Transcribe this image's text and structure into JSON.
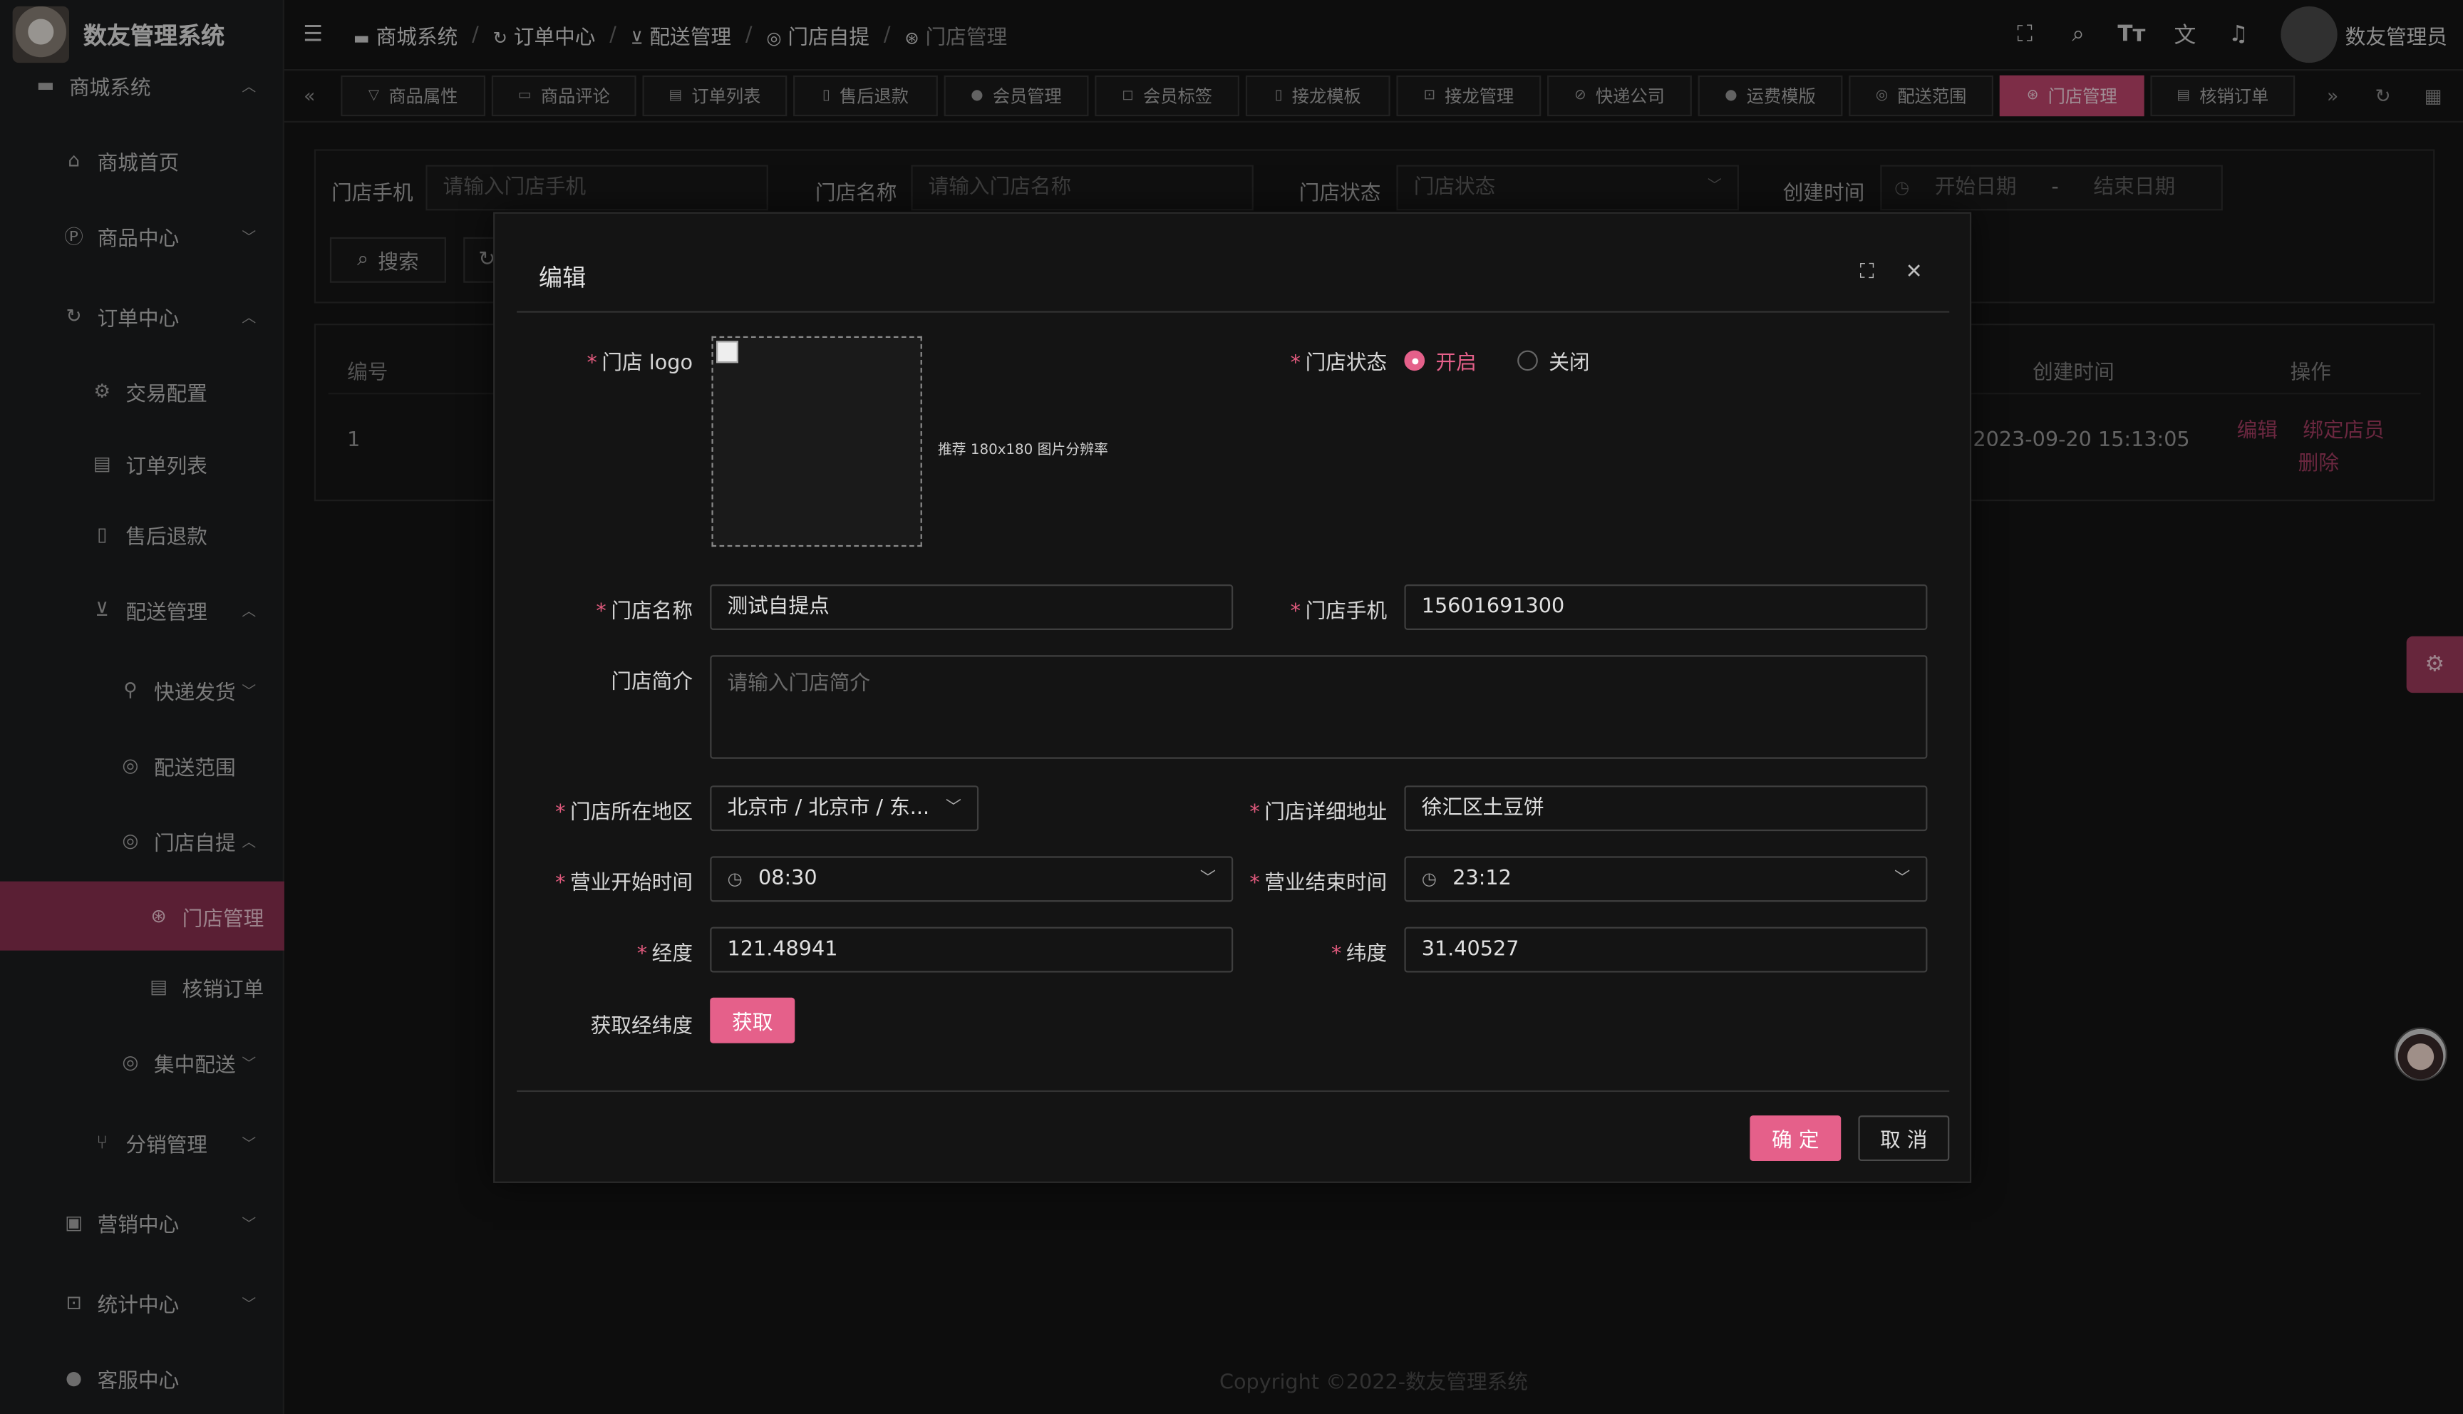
{
  "app": {
    "title": "数友管理系统"
  },
  "sidebar": {
    "items": [
      {
        "label": "商城系统",
        "icon": "store-icon",
        "chevron": "︿"
      },
      {
        "label": "商城首页",
        "icon": "home-icon",
        "chevron": ""
      },
      {
        "label": "商品中心",
        "icon": "product-icon",
        "chevron": "﹀"
      },
      {
        "label": "订单中心",
        "icon": "order-icon",
        "chevron": "︿"
      },
      {
        "label": "交易配置",
        "icon": "gear-icon",
        "chevron": ""
      },
      {
        "label": "订单列表",
        "icon": "clipboard-icon",
        "chevron": ""
      },
      {
        "label": "售后退款",
        "icon": "document-icon",
        "chevron": ""
      },
      {
        "label": "配送管理",
        "icon": "cart-icon",
        "chevron": "︿"
      },
      {
        "label": "快递发货",
        "icon": "bike-icon",
        "chevron": "﹀"
      },
      {
        "label": "配送范围",
        "icon": "location-icon",
        "chevron": ""
      },
      {
        "label": "门店自提",
        "icon": "location-icon",
        "chevron": "︿"
      },
      {
        "label": "门店管理",
        "icon": "aperture-icon",
        "chevron": ""
      },
      {
        "label": "核销订单",
        "icon": "clipboard-icon",
        "chevron": ""
      },
      {
        "label": "集中配送",
        "icon": "location-icon",
        "chevron": "﹀"
      },
      {
        "label": "分销管理",
        "icon": "share-icon",
        "chevron": "﹀"
      },
      {
        "label": "营销中心",
        "icon": "gift-icon",
        "chevron": "﹀"
      },
      {
        "label": "统计中心",
        "icon": "chart-icon",
        "chevron": "﹀"
      },
      {
        "label": "客服中心",
        "icon": "user-icon",
        "chevron": ""
      }
    ]
  },
  "breadcrumb": [
    {
      "label": "商城系统"
    },
    {
      "label": "订单中心"
    },
    {
      "label": "配送管理"
    },
    {
      "label": "门店自提"
    },
    {
      "label": "门店管理"
    }
  ],
  "header": {
    "username": "数友管理员"
  },
  "tabs": [
    {
      "label": "商品属性",
      "icon": "tag-icon"
    },
    {
      "label": "商品评论",
      "icon": "comment-icon"
    },
    {
      "label": "订单列表",
      "icon": "clipboard-icon"
    },
    {
      "label": "售后退款",
      "icon": "document-icon"
    },
    {
      "label": "会员管理",
      "icon": "user-icon"
    },
    {
      "label": "会员标签",
      "icon": "bookmark-icon"
    },
    {
      "label": "接龙模板",
      "icon": "file-icon"
    },
    {
      "label": "接龙管理",
      "icon": "chart-icon"
    },
    {
      "label": "快递公司",
      "icon": "check-circle-icon"
    },
    {
      "label": "运费模版",
      "icon": "user-icon"
    },
    {
      "label": "配送范围",
      "icon": "location-icon"
    },
    {
      "label": "门店管理",
      "icon": "aperture-icon",
      "active": true
    },
    {
      "label": "核销订单",
      "icon": "clipboard-icon"
    }
  ],
  "search": {
    "phone_label": "门店手机",
    "phone_placeholder": "请输入门店手机",
    "name_label": "门店名称",
    "name_placeholder": "请输入门店名称",
    "status_label": "门店状态",
    "status_placeholder": "门店状态",
    "created_label": "创建时间",
    "start_placeholder": "开始日期",
    "range_sep": "-",
    "end_placeholder": "结束日期",
    "search_button": "搜索"
  },
  "table": {
    "headers": {
      "id": "编号",
      "created": "创建时间",
      "actions": "操作"
    },
    "rows": [
      {
        "id": "1",
        "created": "2023-09-20 15:13:05",
        "edit": "编辑",
        "bind": "绑定店员",
        "delete": "删除"
      }
    ]
  },
  "modal": {
    "title": "编辑",
    "logo_label": "门店 logo",
    "logo_hint": "推荐 180x180 图片分辨率",
    "status_label": "门店状态",
    "status_on": "开启",
    "status_off": "关闭",
    "status_value": "开启",
    "name_label": "门店名称",
    "name_value": "测试自提点",
    "phone_label": "门店手机",
    "phone_value": "15601691300",
    "intro_label": "门店简介",
    "intro_placeholder": "请输入门店简介",
    "region_label": "门店所在地区",
    "region_value": "北京市 / 北京市 / 东...",
    "address_label": "门店详细地址",
    "address_value": "徐汇区土豆饼",
    "open_label": "营业开始时间",
    "open_value": "08:30",
    "close_label": "营业结束时间",
    "close_value": "23:12",
    "lng_label": "经度",
    "lng_value": "121.48941",
    "lat_label": "纬度",
    "lat_value": "31.40527",
    "geo_label": "获取经纬度",
    "geo_button": "获取",
    "confirm_button": "确 定",
    "cancel_button": "取 消",
    "required_mark": "*"
  },
  "footer": {
    "copyright": "Copyright ©2022-数友管理系统"
  },
  "colors": {
    "accent": "#e5608a",
    "sidebar_active": "#8b3151",
    "background": "#141414"
  }
}
